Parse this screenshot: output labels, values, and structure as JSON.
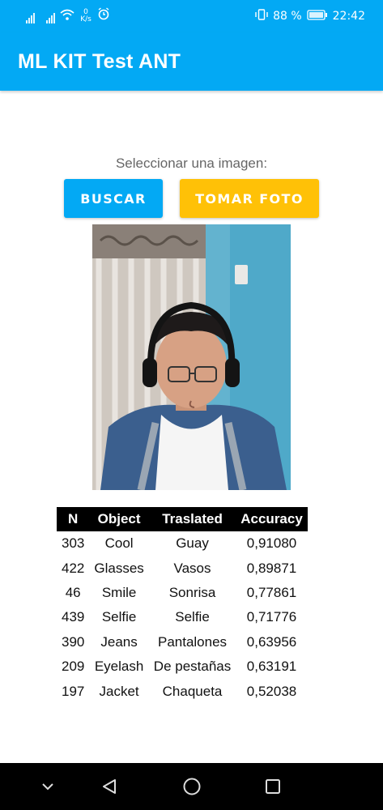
{
  "status_bar": {
    "net_speed_value": "0",
    "net_speed_unit": "K/s",
    "battery": "88 %",
    "time": "22:42",
    "icons": [
      "signal-icon",
      "signal-icon",
      "wifi-icon",
      "alarm-icon",
      "vibrate-icon",
      "battery-icon"
    ]
  },
  "app_bar": {
    "title": "ML KIT Test ANT"
  },
  "main": {
    "prompt": "Seleccionar una imagen:",
    "search_button": "BUSCAR",
    "photo_button": "TOMAR FOTO",
    "photo": "selfie-photo"
  },
  "results": {
    "headers": [
      "N",
      "Object",
      "Traslated",
      "Accuracy"
    ],
    "rows": [
      [
        "303",
        "Cool",
        "Guay",
        "0,91080"
      ],
      [
        "422",
        "Glasses",
        "Vasos",
        "0,89871"
      ],
      [
        "46",
        "Smile",
        "Sonrisa",
        "0,77861"
      ],
      [
        "439",
        "Selfie",
        "Selfie",
        "0,71776"
      ],
      [
        "390",
        "Jeans",
        "Pantalones",
        "0,63956"
      ],
      [
        "209",
        "Eyelash",
        "De pestañas",
        "0,63191"
      ],
      [
        "197",
        "Jacket",
        "Chaqueta",
        "0,52038"
      ]
    ]
  },
  "colors": {
    "primary": "#03A9F4",
    "accent": "#FFC107",
    "table_header": "#000000"
  },
  "nav_bar": {
    "icons": [
      "back-icon",
      "home-icon",
      "recents-icon",
      "collapse-icon"
    ]
  }
}
